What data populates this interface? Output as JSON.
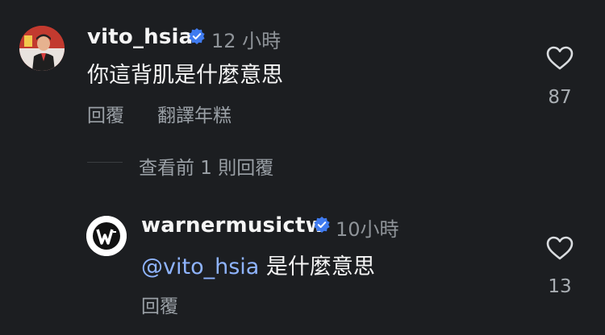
{
  "comment": {
    "username": "vito_hsia",
    "time": "12 小時",
    "text": "你這背肌是什麼意思",
    "reply_label": "回覆",
    "translate_label": "翻譯年糕",
    "like_count": "87",
    "avatar_icon": "user-avatar-photo"
  },
  "view_replies_label": "查看前 1 則回覆",
  "reply": {
    "username": "warnermusictw",
    "time": "10小時",
    "mention": "@vito_hsia",
    "text": " 是什麼意思",
    "reply_label": "回覆",
    "like_count": "13",
    "avatar_icon": "warner-music-logo"
  },
  "colors": {
    "background": "#1c1e21",
    "verified": "#3f7bf0",
    "mention": "#8fb4ff"
  }
}
